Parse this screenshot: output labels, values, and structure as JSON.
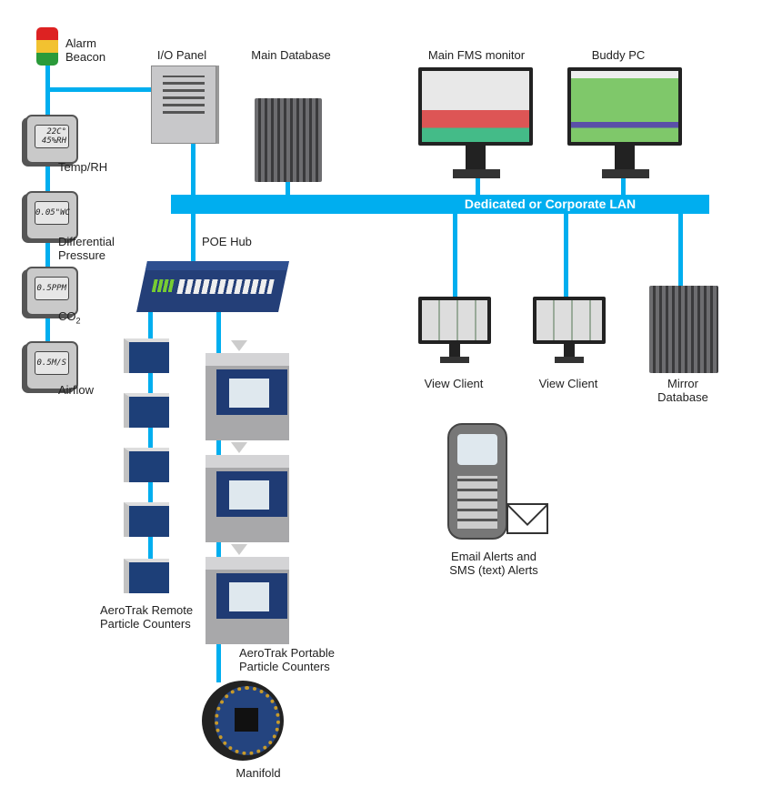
{
  "labels": {
    "alarm_beacon": [
      "Alarm",
      "Beacon"
    ],
    "io_panel": "I/O Panel",
    "main_database": "Main Database",
    "main_fms_monitor": "Main FMS monitor",
    "buddy_pc": "Buddy PC",
    "lan": "Dedicated or Corporate LAN",
    "poe_hub": "POE Hub",
    "temp_rh": "Temp/RH",
    "diff_pressure": [
      "Differential",
      "Pressure"
    ],
    "co2": "CO",
    "co2_sub": "2",
    "airflow": "Airflow",
    "view_client_1": "View Client",
    "view_client_2": "View Client",
    "mirror_database": [
      "Mirror",
      "Database"
    ],
    "email_alerts": [
      "Email Alerts and",
      "SMS (text) Alerts"
    ],
    "remote_counters": [
      "AeroTrak Remote",
      "Particle Counters"
    ],
    "portable_counters": [
      "AeroTrak Portable",
      "Particle Counters"
    ],
    "manifold": "Manifold"
  },
  "sensor_displays": {
    "temp_rh": [
      "22C°",
      "45%RH"
    ],
    "diff_pressure": "0.05\"WC",
    "co2": "0.5PPM",
    "airflow": "0.5M/S"
  },
  "colors": {
    "network_line": "#00aeef",
    "device_blue": "#1f3b74",
    "beacon": [
      "#d22",
      "#f2c230",
      "#2a9a3a"
    ]
  }
}
